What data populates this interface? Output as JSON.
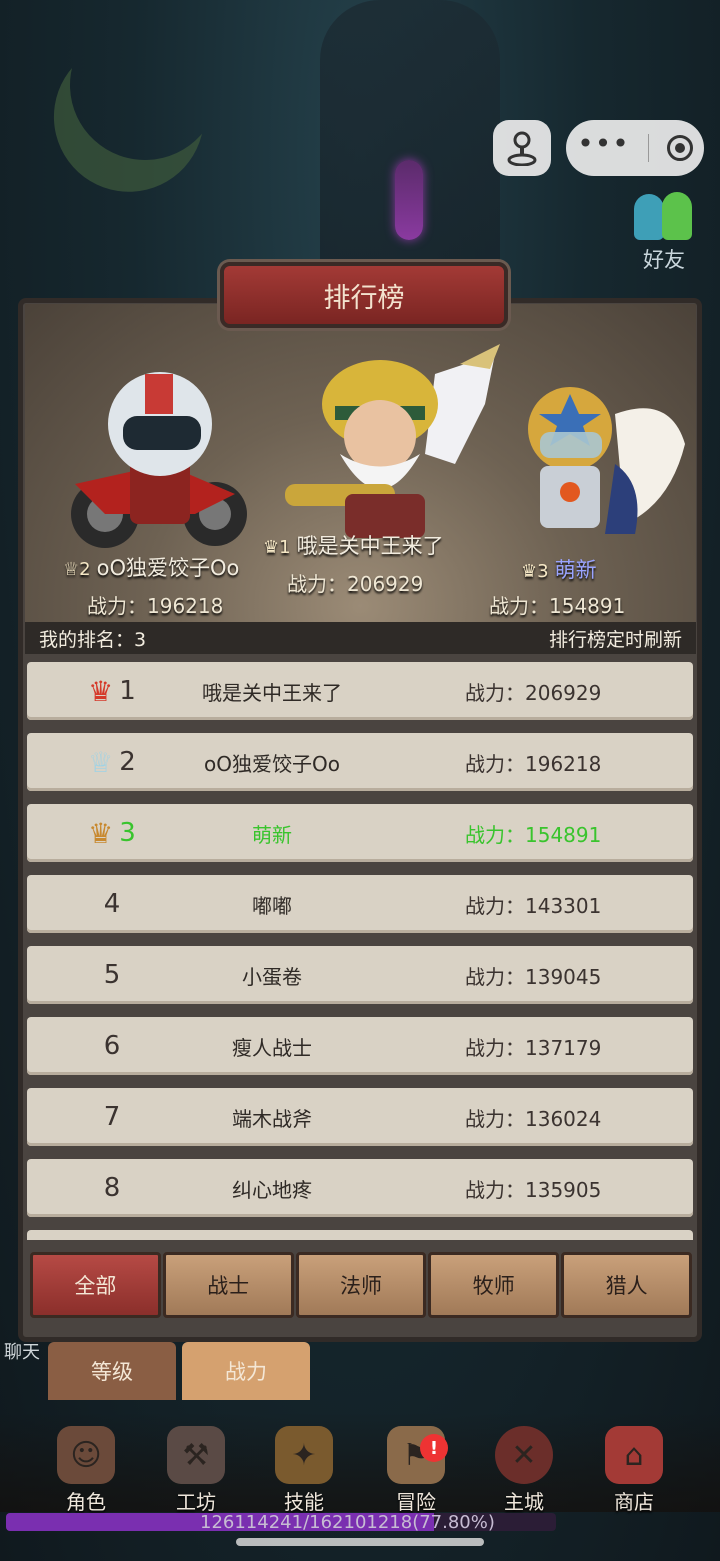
{
  "window": {
    "friends_label": "好友"
  },
  "panel": {
    "title": "排行榜",
    "my_rank_label": "我的排名：3",
    "refresh_note": "排行榜定时刷新"
  },
  "podium": {
    "first": {
      "rank": "1",
      "name": "哦是关中王来了",
      "power": "战力：206929"
    },
    "second": {
      "rank": "2",
      "name": "oO独爱饺子Oo",
      "power": "战力：196218"
    },
    "third": {
      "rank": "3",
      "name": "萌新",
      "power": "战力：154891"
    }
  },
  "rows": [
    {
      "rank": "1",
      "name": "哦是关中王来了",
      "power": "战力：206929"
    },
    {
      "rank": "2",
      "name": "oO独爱饺子Oo",
      "power": "战力：196218"
    },
    {
      "rank": "3",
      "name": "萌新",
      "power": "战力：154891"
    },
    {
      "rank": "4",
      "name": "嘟嘟",
      "power": "战力：143301"
    },
    {
      "rank": "5",
      "name": "小蛋卷",
      "power": "战力：139045"
    },
    {
      "rank": "6",
      "name": "瘦人战士",
      "power": "战力：137179"
    },
    {
      "rank": "7",
      "name": "端木战斧",
      "power": "战力：136024"
    },
    {
      "rank": "8",
      "name": "纠心地疼",
      "power": "战力：135905"
    }
  ],
  "class_tabs": [
    "全部",
    "战士",
    "法师",
    "牧师",
    "猎人"
  ],
  "sort_tabs": {
    "level": "等级",
    "power": "战力"
  },
  "side": {
    "chat": "聊天"
  },
  "nav": {
    "items": [
      "角色",
      "工坊",
      "技能",
      "冒险",
      "主城",
      "商店"
    ],
    "alert": "!"
  },
  "exp": {
    "text": "126114241/162101218(77.80%)",
    "progress": 0.778
  },
  "colors": {
    "self_highlight": "#39c42d",
    "active_tab": "#b64a45",
    "exp_fill": "#7a2fb0"
  }
}
